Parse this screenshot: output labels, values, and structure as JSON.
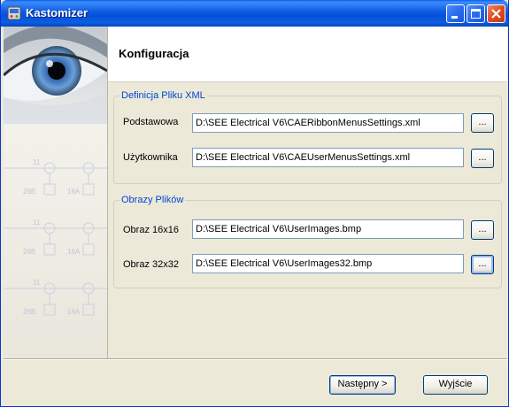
{
  "window": {
    "title": "Kastomizer",
    "icon": "app-icon"
  },
  "header": {
    "title": "Konfiguracja"
  },
  "left_panel": {
    "labels": [
      "11",
      "26B",
      "16A",
      "11",
      "26B",
      "16A",
      "11",
      "26B",
      "16A"
    ]
  },
  "xml_group": {
    "legend": "Definicja Pliku XML",
    "rows": [
      {
        "label": "Podstawowa",
        "value": "D:\\SEE Electrical V6\\CAERibbonMenusSettings.xml",
        "browse": "..."
      },
      {
        "label": "Użytkownika",
        "value": "D:\\SEE Electrical V6\\CAEUserMenusSettings.xml",
        "browse": "..."
      }
    ]
  },
  "images_group": {
    "legend": "Obrazy Plików",
    "rows": [
      {
        "label": "Obraz 16x16",
        "value": "D:\\SEE Electrical V6\\UserImages.bmp",
        "browse": "..."
      },
      {
        "label": "Obraz 32x32",
        "value": "D:\\SEE Electrical V6\\UserImages32.bmp",
        "browse": "..."
      }
    ]
  },
  "footer": {
    "next_label": "Następny >",
    "exit_label": "Wyjście"
  },
  "colors": {
    "titlebar": "#0a5fe8",
    "legend": "#0046d5",
    "window_bg": "#ece9d8"
  }
}
